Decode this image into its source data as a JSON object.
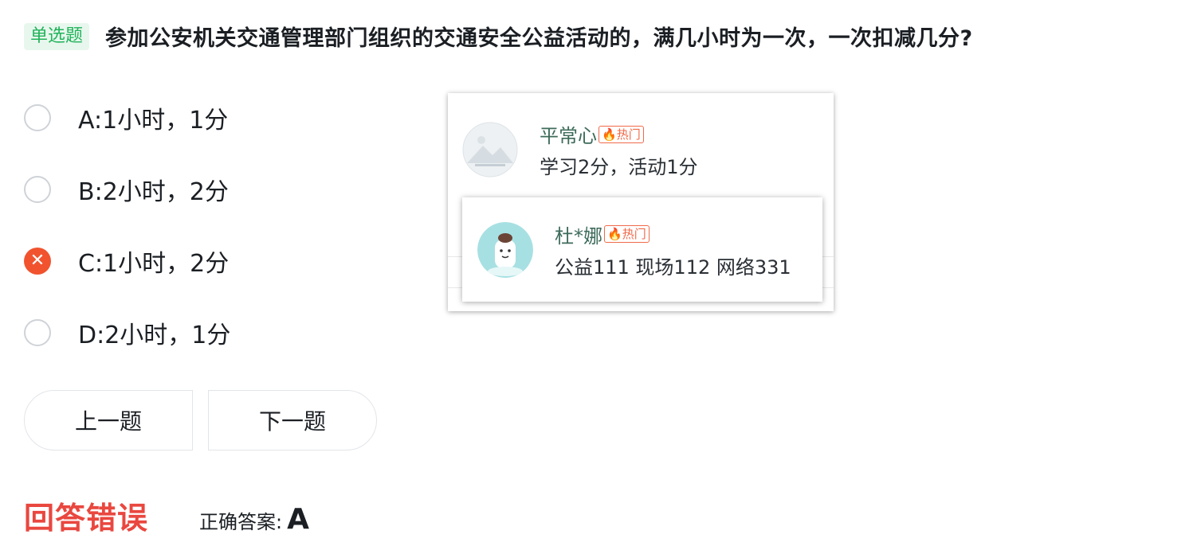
{
  "question": {
    "type_label": "单选题",
    "text": "参加公安机关交通管理部门组织的交通安全公益活动的，满几小时为一次，一次扣减几分?"
  },
  "options": [
    {
      "label": "A:1小时，1分",
      "state": "unselected"
    },
    {
      "label": "B:2小时，2分",
      "state": "unselected"
    },
    {
      "label": "C:1小时，2分",
      "state": "wrong"
    },
    {
      "label": "D:2小时，1分",
      "state": "unselected"
    }
  ],
  "nav": {
    "prev_label": "上一题",
    "next_label": "下一题"
  },
  "result": {
    "status": "回答错误",
    "answer_label": "正确答案:",
    "answer_value": "A"
  },
  "popup": {
    "comments": [
      {
        "name": "平常心",
        "badge": "热门",
        "text": "学习2分，活动1分",
        "avatar_icon": "landscape-placeholder-icon"
      },
      {
        "name": "杜*娜",
        "badge": "热门",
        "text": "公益111 现场112 网络331",
        "avatar_icon": "cartoon-avatar-icon"
      }
    ]
  },
  "colors": {
    "type_green": "#21b35a",
    "wrong_red": "#f1532e",
    "status_red": "#e9473f",
    "hot_orange": "#f06a4a",
    "username_green": "#3d6b5a"
  }
}
